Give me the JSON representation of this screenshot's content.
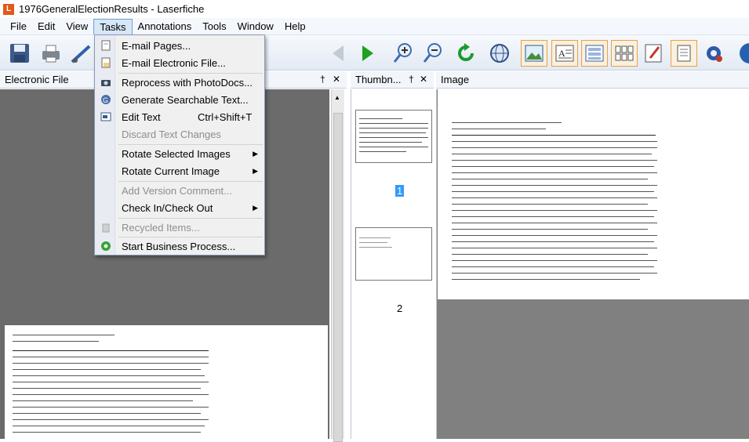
{
  "window": {
    "title": "1976GeneralElectionResults - Laserfiche",
    "logo_letter": "L"
  },
  "menubar": {
    "items": [
      "File",
      "Edit",
      "View",
      "Tasks",
      "Annotations",
      "Tools",
      "Window",
      "Help"
    ],
    "active": "Tasks"
  },
  "tasks_menu": {
    "email_pages": "E-mail Pages...",
    "email_electronic": "E-mail Electronic File...",
    "reprocess": "Reprocess with PhotoDocs...",
    "generate_text": "Generate Searchable Text...",
    "edit_text": "Edit Text",
    "edit_text_shortcut": "Ctrl+Shift+T",
    "discard_text": "Discard Text Changes",
    "rotate_selected": "Rotate Selected Images",
    "rotate_current": "Rotate Current Image",
    "add_version": "Add Version Comment...",
    "check_in_out": "Check In/Check Out",
    "recycled": "Recycled Items...",
    "start_business": "Start Business Process..."
  },
  "panels": {
    "electronic_file": "Electronic File",
    "thumbnails": "Thumbn...",
    "image": "Image",
    "pin_glyph": "†",
    "close_glyph": "✕"
  },
  "thumbnails": {
    "page1": "1",
    "page2": "2"
  },
  "colors": {
    "accent": "#3399ff",
    "logo": "#e05a1a",
    "menu_highlight": "#d6e7f8"
  }
}
